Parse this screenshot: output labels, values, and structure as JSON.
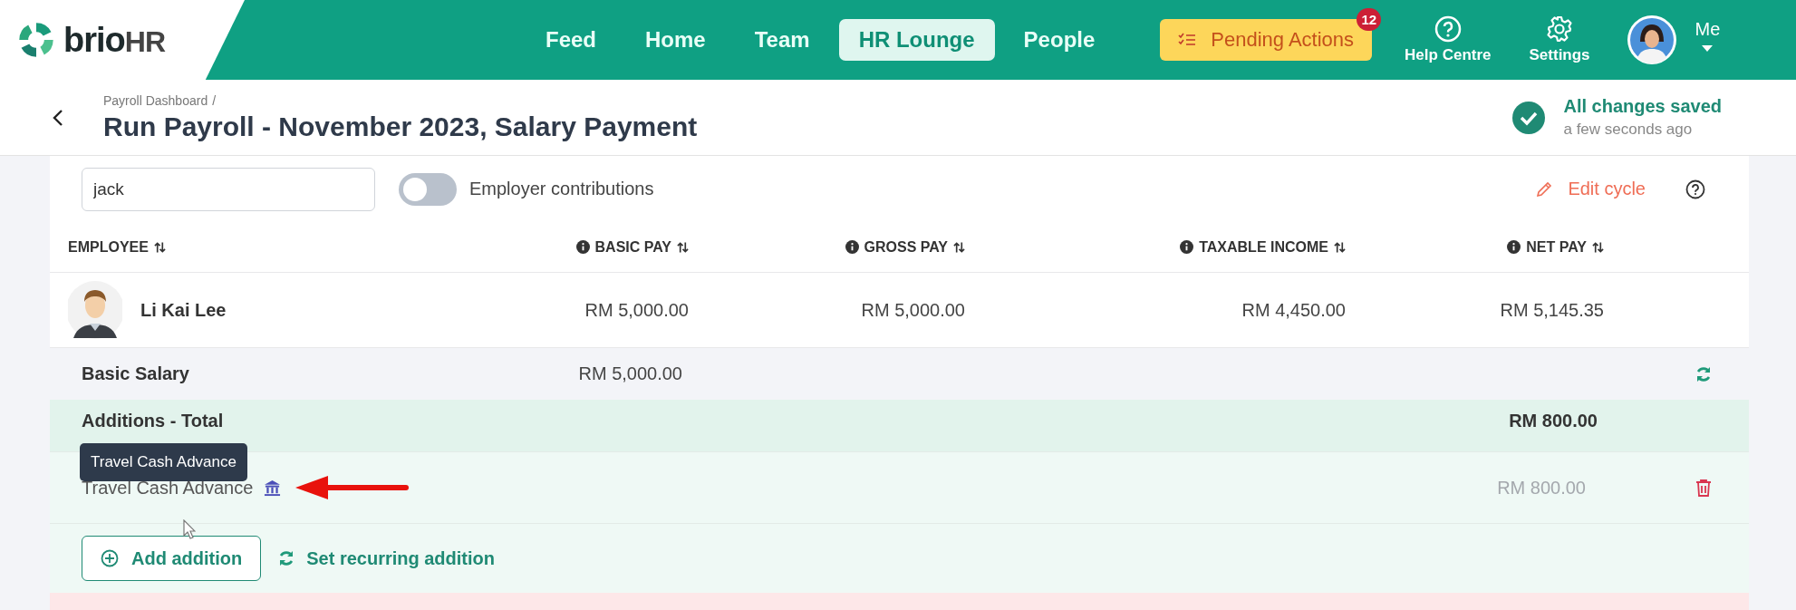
{
  "brand": {
    "name": "brio",
    "suffix": "HR"
  },
  "nav": {
    "tabs": [
      {
        "label": "Feed",
        "selected": false
      },
      {
        "label": "Home",
        "selected": false
      },
      {
        "label": "Team",
        "selected": false
      },
      {
        "label": "HR Lounge",
        "selected": true
      },
      {
        "label": "People",
        "selected": false
      }
    ],
    "pending": {
      "label": "Pending Actions",
      "count": "12"
    },
    "help": "Help Centre",
    "settings": "Settings",
    "user": "Me"
  },
  "page": {
    "breadcrumb": "Payroll Dashboard",
    "separator": "/",
    "title": "Run Payroll - November 2023, Salary Payment",
    "status": "All changes saved",
    "status_time": "a few seconds ago"
  },
  "toolbar": {
    "search": {
      "value": "jack"
    },
    "toggle": {
      "label": "Employer contributions",
      "on": false
    },
    "edit": "Edit cycle"
  },
  "table": {
    "columns": [
      {
        "label": "EMPLOYEE",
        "info": false
      },
      {
        "label": "BASIC PAY",
        "info": true
      },
      {
        "label": "GROSS PAY",
        "info": true
      },
      {
        "label": "TAXABLE INCOME",
        "info": true
      },
      {
        "label": "NET PAY",
        "info": true
      }
    ],
    "employee": {
      "name": "Li Kai Lee",
      "basic_pay": "RM 5,000.00",
      "gross_pay": "RM 5,000.00",
      "taxable_income": "RM 4,450.00",
      "net_pay": "RM 5,145.35"
    },
    "basic_salary": {
      "label": "Basic Salary",
      "amount": "RM 5,000.00"
    },
    "additions_total": {
      "label": "Additions - Total",
      "amount": "RM 800.00"
    },
    "additions": [
      {
        "label": "Travel Cash Advance",
        "amount": "RM 800.00",
        "tooltip": "Travel Cash Advance"
      }
    ],
    "add_button": "Add addition",
    "recurring_link": "Set recurring addition"
  }
}
